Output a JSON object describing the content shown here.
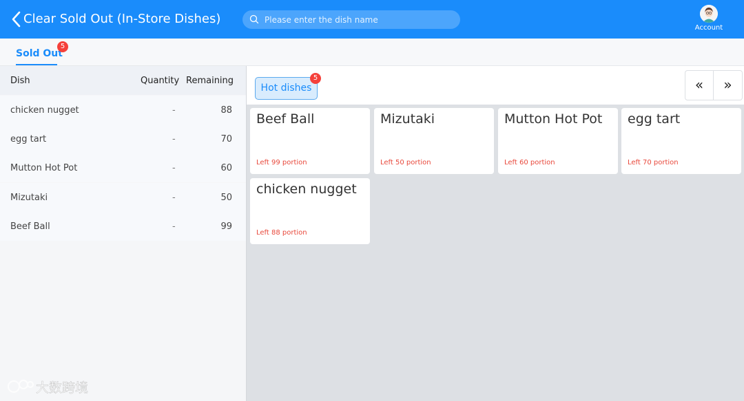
{
  "header": {
    "title": "Clear Sold Out (In-Store Dishes)",
    "search_placeholder": "Please enter the dish name",
    "account_label": "Account"
  },
  "tabs": [
    {
      "label": "Sold Out",
      "badge": "5",
      "active": true
    }
  ],
  "table": {
    "columns": [
      "Dish",
      "Quantity",
      "Remaining"
    ],
    "rows": [
      {
        "name": "chicken nugget",
        "quantity": "-",
        "remaining": "88"
      },
      {
        "name": "egg tart",
        "quantity": "-",
        "remaining": "70"
      },
      {
        "name": "Mutton Hot Pot",
        "quantity": "-",
        "remaining": "60"
      },
      {
        "name": "Mizutaki",
        "quantity": "-",
        "remaining": "50"
      },
      {
        "name": "Beef Ball",
        "quantity": "-",
        "remaining": "99"
      }
    ]
  },
  "category": {
    "label": "Hot dishes",
    "badge": "5"
  },
  "pager": {
    "prev": "«",
    "next": "»"
  },
  "cards": [
    {
      "name": "Beef Ball",
      "left": "Left 99 portion"
    },
    {
      "name": "Mizutaki",
      "left": "Left 50 portion"
    },
    {
      "name": "Mutton Hot Pot",
      "left": "Left 60 portion"
    },
    {
      "name": "egg tart",
      "left": "Left 70 portion"
    },
    {
      "name": "chicken nugget",
      "left": "Left 88 portion"
    }
  ],
  "colors": {
    "primary": "#1a8cfb",
    "badge": "#f5403a",
    "portion_text": "#e8483b"
  },
  "watermark": "大数跨境"
}
